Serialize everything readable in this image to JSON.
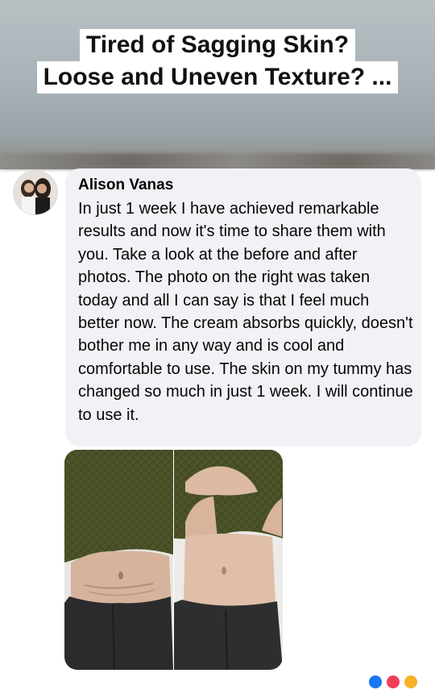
{
  "headline": {
    "line1": "Tired of Sagging Skin?",
    "line2": "Loose and Uneven Texture? ..."
  },
  "comment": {
    "author": "Alison Vanas",
    "text": "In just 1 week I have achieved remarkable results and now it's time to share them with you. Take a look at the before and after photos. The photo on the right was taken today and all I can say is that I feel much better now. The cream absorbs quickly, doesn't bother me in any way and is cool and comfortable to use. The skin on my tummy has changed so much in just 1 week. I will continue to use it."
  },
  "colors": {
    "bubble": "#f0f2f5",
    "sweater": "#4d5429",
    "skin": "#d9b6a0",
    "jeans": "#2b2b2d"
  },
  "icons": {
    "reactions": [
      "like-reaction-icon",
      "love-reaction-icon",
      "care-reaction-icon"
    ]
  }
}
